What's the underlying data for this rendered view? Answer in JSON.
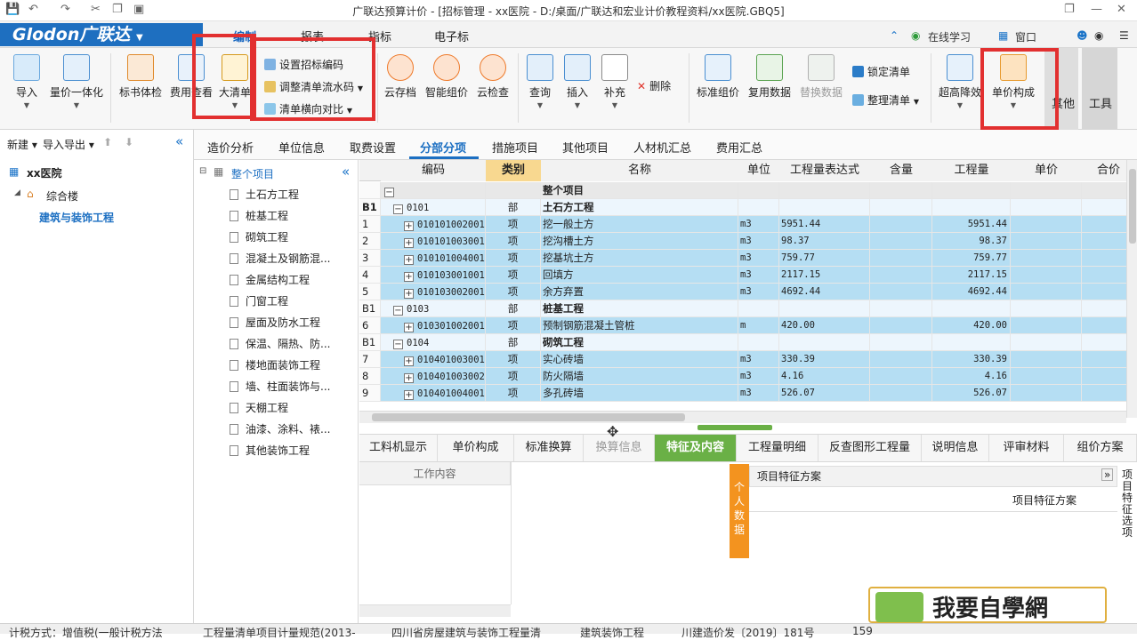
{
  "title": "广联达预算计价 - [招标管理 - xx医院 - D:/桌面/广联达和宏业计价教程资料/xx医院.GBQ5]",
  "brand": {
    "logo": "Glodon广联达"
  },
  "menu_tabs": [
    "编制",
    "报表",
    "指标",
    "电子标"
  ],
  "top_right": {
    "learn": "在线学习",
    "window": "窗口"
  },
  "ribbon": {
    "import": "导入",
    "price_integration": "量价一体化",
    "bid_check": "标书体检",
    "fee_view": "费用查看",
    "big_list": "大清单",
    "set_bid_code": "设置招标编码",
    "adjust_list_no": "调整清单流水码",
    "list_compare": "清单横向对比",
    "cloud_save": "云存档",
    "smart_price": "智能组价",
    "cloud_check": "云检查",
    "query": "查询",
    "insert": "插入",
    "supplement": "补充",
    "delete": "删除",
    "std_price": "标准组价",
    "reuse_data": "复用数据",
    "replace_data": "替换数据",
    "lock_list": "锁定清单",
    "tidy_list": "整理清单",
    "high_cut": "超高降效",
    "unit_price_comp": "单价构成",
    "other": "其他",
    "tools": "工具"
  },
  "left": {
    "new": "新建",
    "import_export": "导入导出",
    "project": "xx医院",
    "building": "综合楼",
    "unit": "建筑与装饰工程"
  },
  "tabs": [
    "造价分析",
    "单位信息",
    "取费设置",
    "分部分项",
    "措施项目",
    "其他项目",
    "人材机汇总",
    "费用汇总"
  ],
  "tree": {
    "root": "整个项目",
    "items": [
      "土石方工程",
      "桩基工程",
      "砌筑工程",
      "混凝土及钢筋混...",
      "金属结构工程",
      "门窗工程",
      "屋面及防水工程",
      "保温、隔热、防...",
      "楼地面装饰工程",
      "墙、柱面装饰与...",
      "天棚工程",
      "油漆、涂料、裱...",
      "其他装饰工程"
    ]
  },
  "grid": {
    "columns": [
      "编码",
      "类别",
      "名称",
      "单位",
      "工程量表达式",
      "含量",
      "工程量",
      "单价",
      "合价"
    ],
    "rows": [
      {
        "no": "",
        "code": "",
        "type": "",
        "name": "整个项目",
        "unit": "",
        "expr": "",
        "qty": "",
        "kind": "root"
      },
      {
        "no": "B1",
        "code": "0101",
        "type": "部",
        "name": "土石方工程",
        "unit": "",
        "expr": "",
        "qty": "",
        "kind": "section"
      },
      {
        "no": "1",
        "code": "010101002001",
        "type": "项",
        "name": "挖一般土方",
        "unit": "m3",
        "expr": "5951.44",
        "qty": "5951.44",
        "kind": "item"
      },
      {
        "no": "2",
        "code": "010101003001",
        "type": "项",
        "name": "挖沟槽土方",
        "unit": "m3",
        "expr": "98.37",
        "qty": "98.37",
        "kind": "item"
      },
      {
        "no": "3",
        "code": "010101004001",
        "type": "项",
        "name": "挖基坑土方",
        "unit": "m3",
        "expr": "759.77",
        "qty": "759.77",
        "kind": "item"
      },
      {
        "no": "4",
        "code": "010103001001",
        "type": "项",
        "name": "回填方",
        "unit": "m3",
        "expr": "2117.15",
        "qty": "2117.15",
        "kind": "item"
      },
      {
        "no": "5",
        "code": "010103002001",
        "type": "项",
        "name": "余方弃置",
        "unit": "m3",
        "expr": "4692.44",
        "qty": "4692.44",
        "kind": "item"
      },
      {
        "no": "B1",
        "code": "0103",
        "type": "部",
        "name": "桩基工程",
        "unit": "",
        "expr": "",
        "qty": "",
        "kind": "section"
      },
      {
        "no": "6",
        "code": "010301002001",
        "type": "项",
        "name": "预制钢筋混凝土管桩",
        "unit": "m",
        "expr": "420.00",
        "qty": "420.00",
        "kind": "item"
      },
      {
        "no": "B1",
        "code": "0104",
        "type": "部",
        "name": "砌筑工程",
        "unit": "",
        "expr": "",
        "qty": "",
        "kind": "section"
      },
      {
        "no": "7",
        "code": "010401003001",
        "type": "项",
        "name": "实心砖墙",
        "unit": "m3",
        "expr": "330.39",
        "qty": "330.39",
        "kind": "item"
      },
      {
        "no": "8",
        "code": "010401003002",
        "type": "项",
        "name": "防火隔墙",
        "unit": "m3",
        "expr": "4.16",
        "qty": "4.16",
        "kind": "item"
      },
      {
        "no": "9",
        "code": "010401004001",
        "type": "项",
        "name": "多孔砖墙",
        "unit": "m3",
        "expr": "526.07",
        "qty": "526.07",
        "kind": "item"
      }
    ]
  },
  "bottom_tabs": [
    "工料机显示",
    "单价构成",
    "标准换算",
    "换算信息",
    "特征及内容",
    "工程量明细",
    "反查图形工程量",
    "说明信息",
    "评审材料",
    "组价方案"
  ],
  "detail": {
    "work_content": "工作内容",
    "feature_plan_title": "项目特征方案",
    "feature_plan_col": "项目特征方案",
    "personal_data": "个人数据",
    "side_label": "项目特征选项"
  },
  "watermark": "我要自學網",
  "status": [
    "计税方式：增值税(一般计税方法",
    "工程量清单项目计量规范(2013-",
    "四川省房屋建筑与装饰工程量清",
    "建筑装饰工程",
    "川建造价发〔2019〕181号",
    "159"
  ],
  "colors": {
    "accent": "#1c6fc2",
    "selected_row": "#b5def3",
    "highlight_tab": "#6ab046",
    "red_box": "#e23030"
  }
}
